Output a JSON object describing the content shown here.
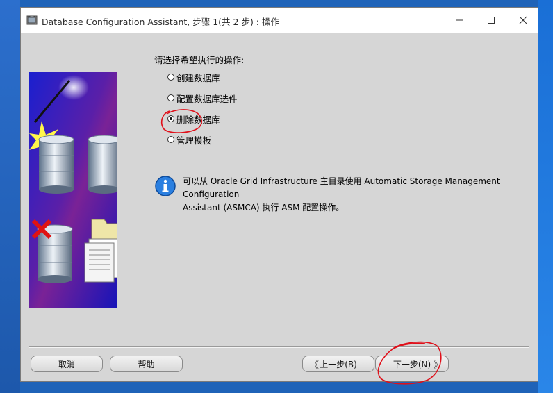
{
  "window": {
    "title": "Database Configuration Assistant, 步骤 1(共 2 步) : 操作",
    "minimize": "—",
    "maximize": "☐",
    "close": "✕"
  },
  "content": {
    "prompt": "请选择希望执行的操作:",
    "options": [
      {
        "label": "创建数据库",
        "selected": false
      },
      {
        "label": "配置数据库选件",
        "selected": false
      },
      {
        "label": "删除数据库",
        "selected": true
      },
      {
        "label": "管理模板",
        "selected": false
      }
    ],
    "info": {
      "line1": "可以从 Oracle Grid Infrastructure 主目录使用 Automatic Storage Management Configuration",
      "line2": "Assistant (ASMCA) 执行 ASM 配置操作。"
    }
  },
  "footer": {
    "cancel": "取消",
    "help": "帮助",
    "back": "上一步(B)",
    "next": "下一步(N)",
    "back_arrow": "《",
    "next_arrow": "》"
  },
  "colors": {
    "window_bg": "#d6d6d6",
    "banner_bg": "#3a1fa8",
    "annotation": "#e0101a",
    "info_icon": "#1c6fd8"
  }
}
